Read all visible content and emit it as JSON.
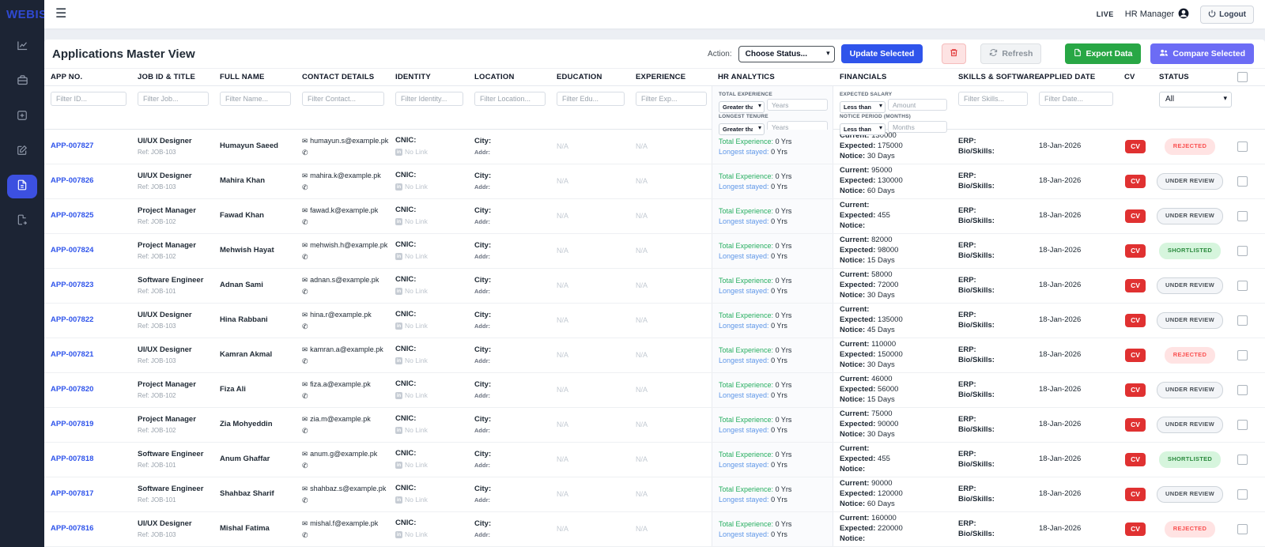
{
  "sidebar": {
    "logo": "WEBISTAN",
    "items": [
      {
        "icon": "analytics-chart-icon"
      },
      {
        "icon": "jobs-briefcase-icon"
      },
      {
        "icon": "add-square-icon"
      },
      {
        "icon": "edit-pencil-icon"
      },
      {
        "icon": "applications-file-icon",
        "active": true
      },
      {
        "icon": "report-export-icon"
      }
    ],
    "accent_color": "#3c50e0",
    "background_color": "#1c2434"
  },
  "topbar": {
    "live": "LIVE",
    "user": "HR Manager",
    "logout": "Logout"
  },
  "page": {
    "title": "Applications Master View"
  },
  "actions": {
    "action_label": "Action:",
    "choose_status": "Choose Status...",
    "update_selected": "Update Selected",
    "refresh": "Refresh",
    "export": "Export Data",
    "compare": "Compare Selected"
  },
  "table": {
    "headers": [
      "APP NO.",
      "JOB ID & TITLE",
      "FULL NAME",
      "CONTACT DETAILS",
      "IDENTITY",
      "LOCATION",
      "EDUCATION",
      "EXPERIENCE",
      "HR ANALYTICS",
      "FINANCIALS",
      "SKILLS & SOFTWARE",
      "APPLIED DATE",
      "CV",
      "STATUS"
    ],
    "filters": {
      "id": "Filter ID...",
      "job": "Filter Job...",
      "name": "Filter Name...",
      "contact": "Filter Contact...",
      "identity": "Filter Identity...",
      "location": "Filter Location...",
      "edu": "Filter Edu...",
      "exp": "Filter Exp...",
      "skills": "Filter Skills...",
      "date": "Filter Date...",
      "status_all": "All"
    },
    "hr_filters": {
      "total_label": "TOTAL EXPERIENCE",
      "tenure_label": "LONGEST TENURE",
      "op": "Greater tha",
      "years_ph": "Years"
    },
    "fin_filters": {
      "salary_label": "EXPECTED SALARY",
      "notice_label": "NOTICE PERIOD (MONTHS)",
      "op": "Less than",
      "amount_ph": "Amount",
      "months_ph": "Months"
    },
    "labels": {
      "cnic": "CNIC:",
      "no_link": "No Link",
      "city": "City:",
      "addr": "Addr:",
      "na_edu": "N/A",
      "na_exp": "N/A",
      "total_exp": "Total Experience:",
      "longest": "Longest stayed:",
      "exp_val": "0 Yrs",
      "current": "Current:",
      "expected": "Expected:",
      "notice": "Notice:",
      "erp": "ERP:",
      "bio": "Bio/Skills:",
      "cv": "CV"
    },
    "rows": [
      {
        "app_no": "APP-007827",
        "job_title": "UI/UX Designer",
        "job_ref": "Ref: JOB-103",
        "name": "Humayun Saeed",
        "email": "humayun.s@example.pk",
        "current": "130000",
        "expected": "175000",
        "notice": "30 Days",
        "date": "18-Jan-2026",
        "status": "REJECTED",
        "status_type": "rejected"
      },
      {
        "app_no": "APP-007826",
        "job_title": "UI/UX Designer",
        "job_ref": "Ref: JOB-103",
        "name": "Mahira Khan",
        "email": "mahira.k@example.pk",
        "current": "95000",
        "expected": "130000",
        "notice": "60 Days",
        "date": "18-Jan-2026",
        "status": "UNDER REVIEW",
        "status_type": "under_review"
      },
      {
        "app_no": "APP-007825",
        "job_title": "Project Manager",
        "job_ref": "Ref: JOB-102",
        "name": "Fawad Khan",
        "email": "fawad.k@example.pk",
        "current": "",
        "expected": "455",
        "notice": "",
        "date": "18-Jan-2026",
        "status": "UNDER REVIEW",
        "status_type": "under_review"
      },
      {
        "app_no": "APP-007824",
        "job_title": "Project Manager",
        "job_ref": "Ref: JOB-102",
        "name": "Mehwish Hayat",
        "email": "mehwish.h@example.pk",
        "current": "82000",
        "expected": "98000",
        "notice": "15 Days",
        "date": "18-Jan-2026",
        "status": "SHORTLISTED",
        "status_type": "shortlisted"
      },
      {
        "app_no": "APP-007823",
        "job_title": "Software Engineer",
        "job_ref": "Ref: JOB-101",
        "name": "Adnan Sami",
        "email": "adnan.s@example.pk",
        "current": "58000",
        "expected": "72000",
        "notice": "30 Days",
        "date": "18-Jan-2026",
        "status": "UNDER REVIEW",
        "status_type": "under_review"
      },
      {
        "app_no": "APP-007822",
        "job_title": "UI/UX Designer",
        "job_ref": "Ref: JOB-103",
        "name": "Hina Rabbani",
        "email": "hina.r@example.pk",
        "current": "",
        "expected": "135000",
        "notice": "45 Days",
        "date": "18-Jan-2026",
        "status": "UNDER REVIEW",
        "status_type": "under_review"
      },
      {
        "app_no": "APP-007821",
        "job_title": "UI/UX Designer",
        "job_ref": "Ref: JOB-103",
        "name": "Kamran Akmal",
        "email": "kamran.a@example.pk",
        "current": "110000",
        "expected": "150000",
        "notice": "30 Days",
        "date": "18-Jan-2026",
        "status": "REJECTED",
        "status_type": "rejected"
      },
      {
        "app_no": "APP-007820",
        "job_title": "Project Manager",
        "job_ref": "Ref: JOB-102",
        "name": "Fiza Ali",
        "email": "fiza.a@example.pk",
        "current": "46000",
        "expected": "56000",
        "notice": "15 Days",
        "date": "18-Jan-2026",
        "status": "UNDER REVIEW",
        "status_type": "under_review"
      },
      {
        "app_no": "APP-007819",
        "job_title": "Project Manager",
        "job_ref": "Ref: JOB-102",
        "name": "Zia Mohyeddin",
        "email": "zia.m@example.pk",
        "current": "75000",
        "expected": "90000",
        "notice": "30 Days",
        "date": "18-Jan-2026",
        "status": "UNDER REVIEW",
        "status_type": "under_review"
      },
      {
        "app_no": "APP-007818",
        "job_title": "Software Engineer",
        "job_ref": "Ref: JOB-101",
        "name": "Anum Ghaffar",
        "email": "anum.g@example.pk",
        "current": "",
        "expected": "455",
        "notice": "",
        "date": "18-Jan-2026",
        "status": "SHORTLISTED",
        "status_type": "shortlisted"
      },
      {
        "app_no": "APP-007817",
        "job_title": "Software Engineer",
        "job_ref": "Ref: JOB-101",
        "name": "Shahbaz Sharif",
        "email": "shahbaz.s@example.pk",
        "current": "90000",
        "expected": "120000",
        "notice": "60 Days",
        "date": "18-Jan-2026",
        "status": "UNDER REVIEW",
        "status_type": "under_review"
      },
      {
        "app_no": "APP-007816",
        "job_title": "UI/UX Designer",
        "job_ref": "Ref: JOB-103",
        "name": "Mishal Fatima",
        "email": "mishal.f@example.pk",
        "current": "160000",
        "expected": "220000",
        "notice": "",
        "date": "18-Jan-2026",
        "status": "REJECTED",
        "status_type": "rejected"
      }
    ]
  }
}
